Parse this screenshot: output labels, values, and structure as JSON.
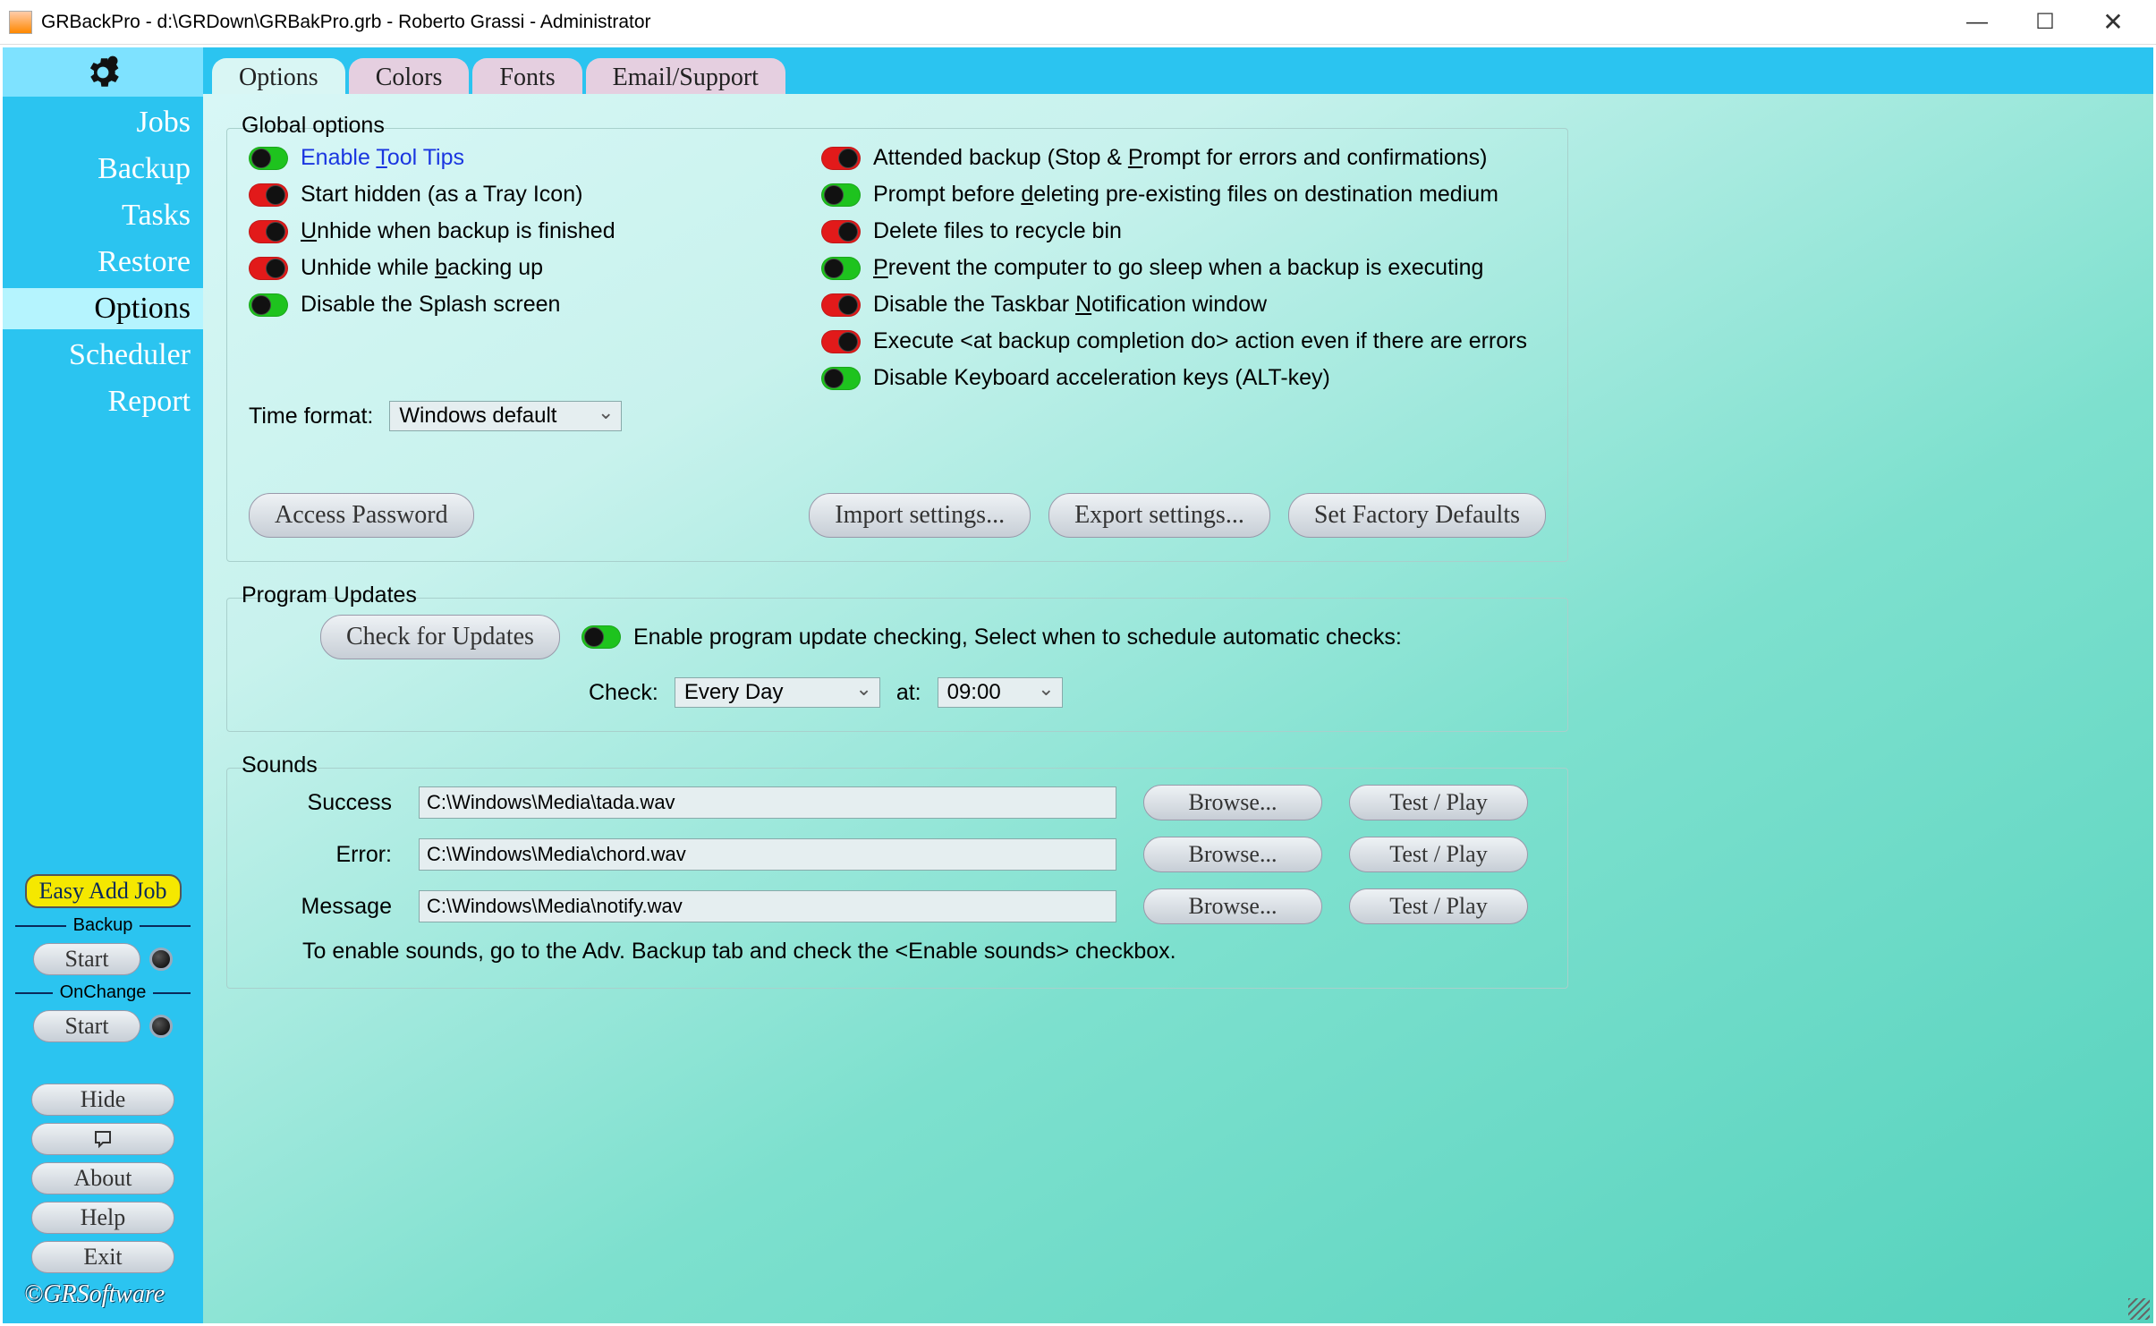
{
  "window": {
    "title": "GRBackPro - d:\\GRDown\\GRBakPro.grb - Roberto Grassi - Administrator"
  },
  "sidebar": {
    "items": [
      "Jobs",
      "Backup",
      "Tasks",
      "Restore",
      "Options",
      "Scheduler",
      "Report"
    ],
    "active": "Options",
    "easy_add": "Easy Add Job",
    "backup_label": "Backup",
    "onchange_label": "OnChange",
    "start": "Start",
    "hide": "Hide",
    "about": "About",
    "help": "Help",
    "exit": "Exit",
    "copyright": "©GRSoftware"
  },
  "tabs": [
    "Options",
    "Colors",
    "Fonts",
    "Email/Support"
  ],
  "global": {
    "legend": "Global options",
    "left": [
      {
        "on": true,
        "label": "Enable Tool Tips",
        "underline": "T",
        "tooltip": true
      },
      {
        "on": false,
        "label": "Start hidden (as a Tray Icon)",
        "underline": null
      },
      {
        "on": false,
        "label": "Unhide when backup is finished",
        "underline": "U"
      },
      {
        "on": false,
        "label": "Unhide while backing up",
        "underline": "b"
      },
      {
        "on": true,
        "label": "Disable the Splash screen",
        "underline": null
      }
    ],
    "right": [
      {
        "on": false,
        "label": "Attended backup (Stop & Prompt for errors and confirmations)",
        "underline": "P"
      },
      {
        "on": true,
        "label": "Prompt before deleting pre-existing files on destination medium",
        "underline": "d"
      },
      {
        "on": false,
        "label": "Delete files to recycle bin",
        "underline": null
      },
      {
        "on": true,
        "label": "Prevent the computer to go sleep when a backup is executing",
        "underline": "P"
      },
      {
        "on": false,
        "label": "Disable the Taskbar Notification window",
        "underline": "N"
      },
      {
        "on": false,
        "label": "Execute <at backup completion do> action even if there are errors",
        "underline": null
      },
      {
        "on": true,
        "label": "Disable Keyboard acceleration keys (ALT-key)",
        "underline": null
      }
    ],
    "time_format_label": "Time format:",
    "time_format_value": "Windows default",
    "access_password": "Access Password",
    "import_settings": "Import settings...",
    "export_settings": "Export settings...",
    "factory_defaults": "Set Factory Defaults"
  },
  "updates": {
    "legend": "Program Updates",
    "check_updates": "Check for Updates",
    "enable_on": true,
    "enable_label": "Enable program update checking, Select when to schedule automatic checks:",
    "check_label": "Check:",
    "check_value": "Every Day",
    "at_label": "at:",
    "at_value": "09:00"
  },
  "sounds": {
    "legend": "Sounds",
    "rows": [
      {
        "label": "Success",
        "path": "C:\\Windows\\Media\\tada.wav"
      },
      {
        "label": "Error:",
        "path": "C:\\Windows\\Media\\chord.wav"
      },
      {
        "label": "Message",
        "path": "C:\\Windows\\Media\\notify.wav"
      }
    ],
    "browse": "Browse...",
    "test": "Test / Play",
    "note": "To enable sounds, go to the Adv. Backup tab and check the <Enable sounds> checkbox."
  }
}
